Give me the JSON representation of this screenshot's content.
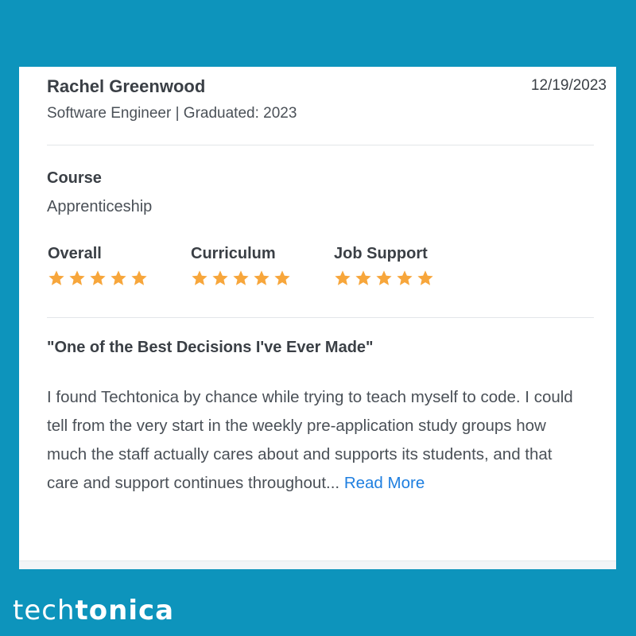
{
  "review": {
    "reviewer_name": "Rachel Greenwood",
    "date": "12/19/2023",
    "meta": "Software Engineer | Graduated: 2023",
    "course_label": "Course",
    "course_value": "Apprenticeship",
    "ratings": [
      {
        "label": "Overall",
        "stars": 5,
        "max": 5
      },
      {
        "label": "Curriculum",
        "stars": 5,
        "max": 5
      },
      {
        "label": "Job Support",
        "stars": 5,
        "max": 5
      }
    ],
    "title": "\"One of the Best Decisions I've Ever Made\"",
    "body": "I found Techtonica by chance while trying to teach myself to code. I could tell from the very start in the weekly pre-application study groups how much the staff actually cares about and supports its students, and that care and support continues throughout...",
    "read_more": "Read More"
  },
  "brand": {
    "logo_part1": "tech",
    "logo_part2": "tonica"
  },
  "colors": {
    "background": "#0d94bc",
    "star": "#f7a63b",
    "link": "#1f7fe0",
    "text": "#3a3f45"
  }
}
